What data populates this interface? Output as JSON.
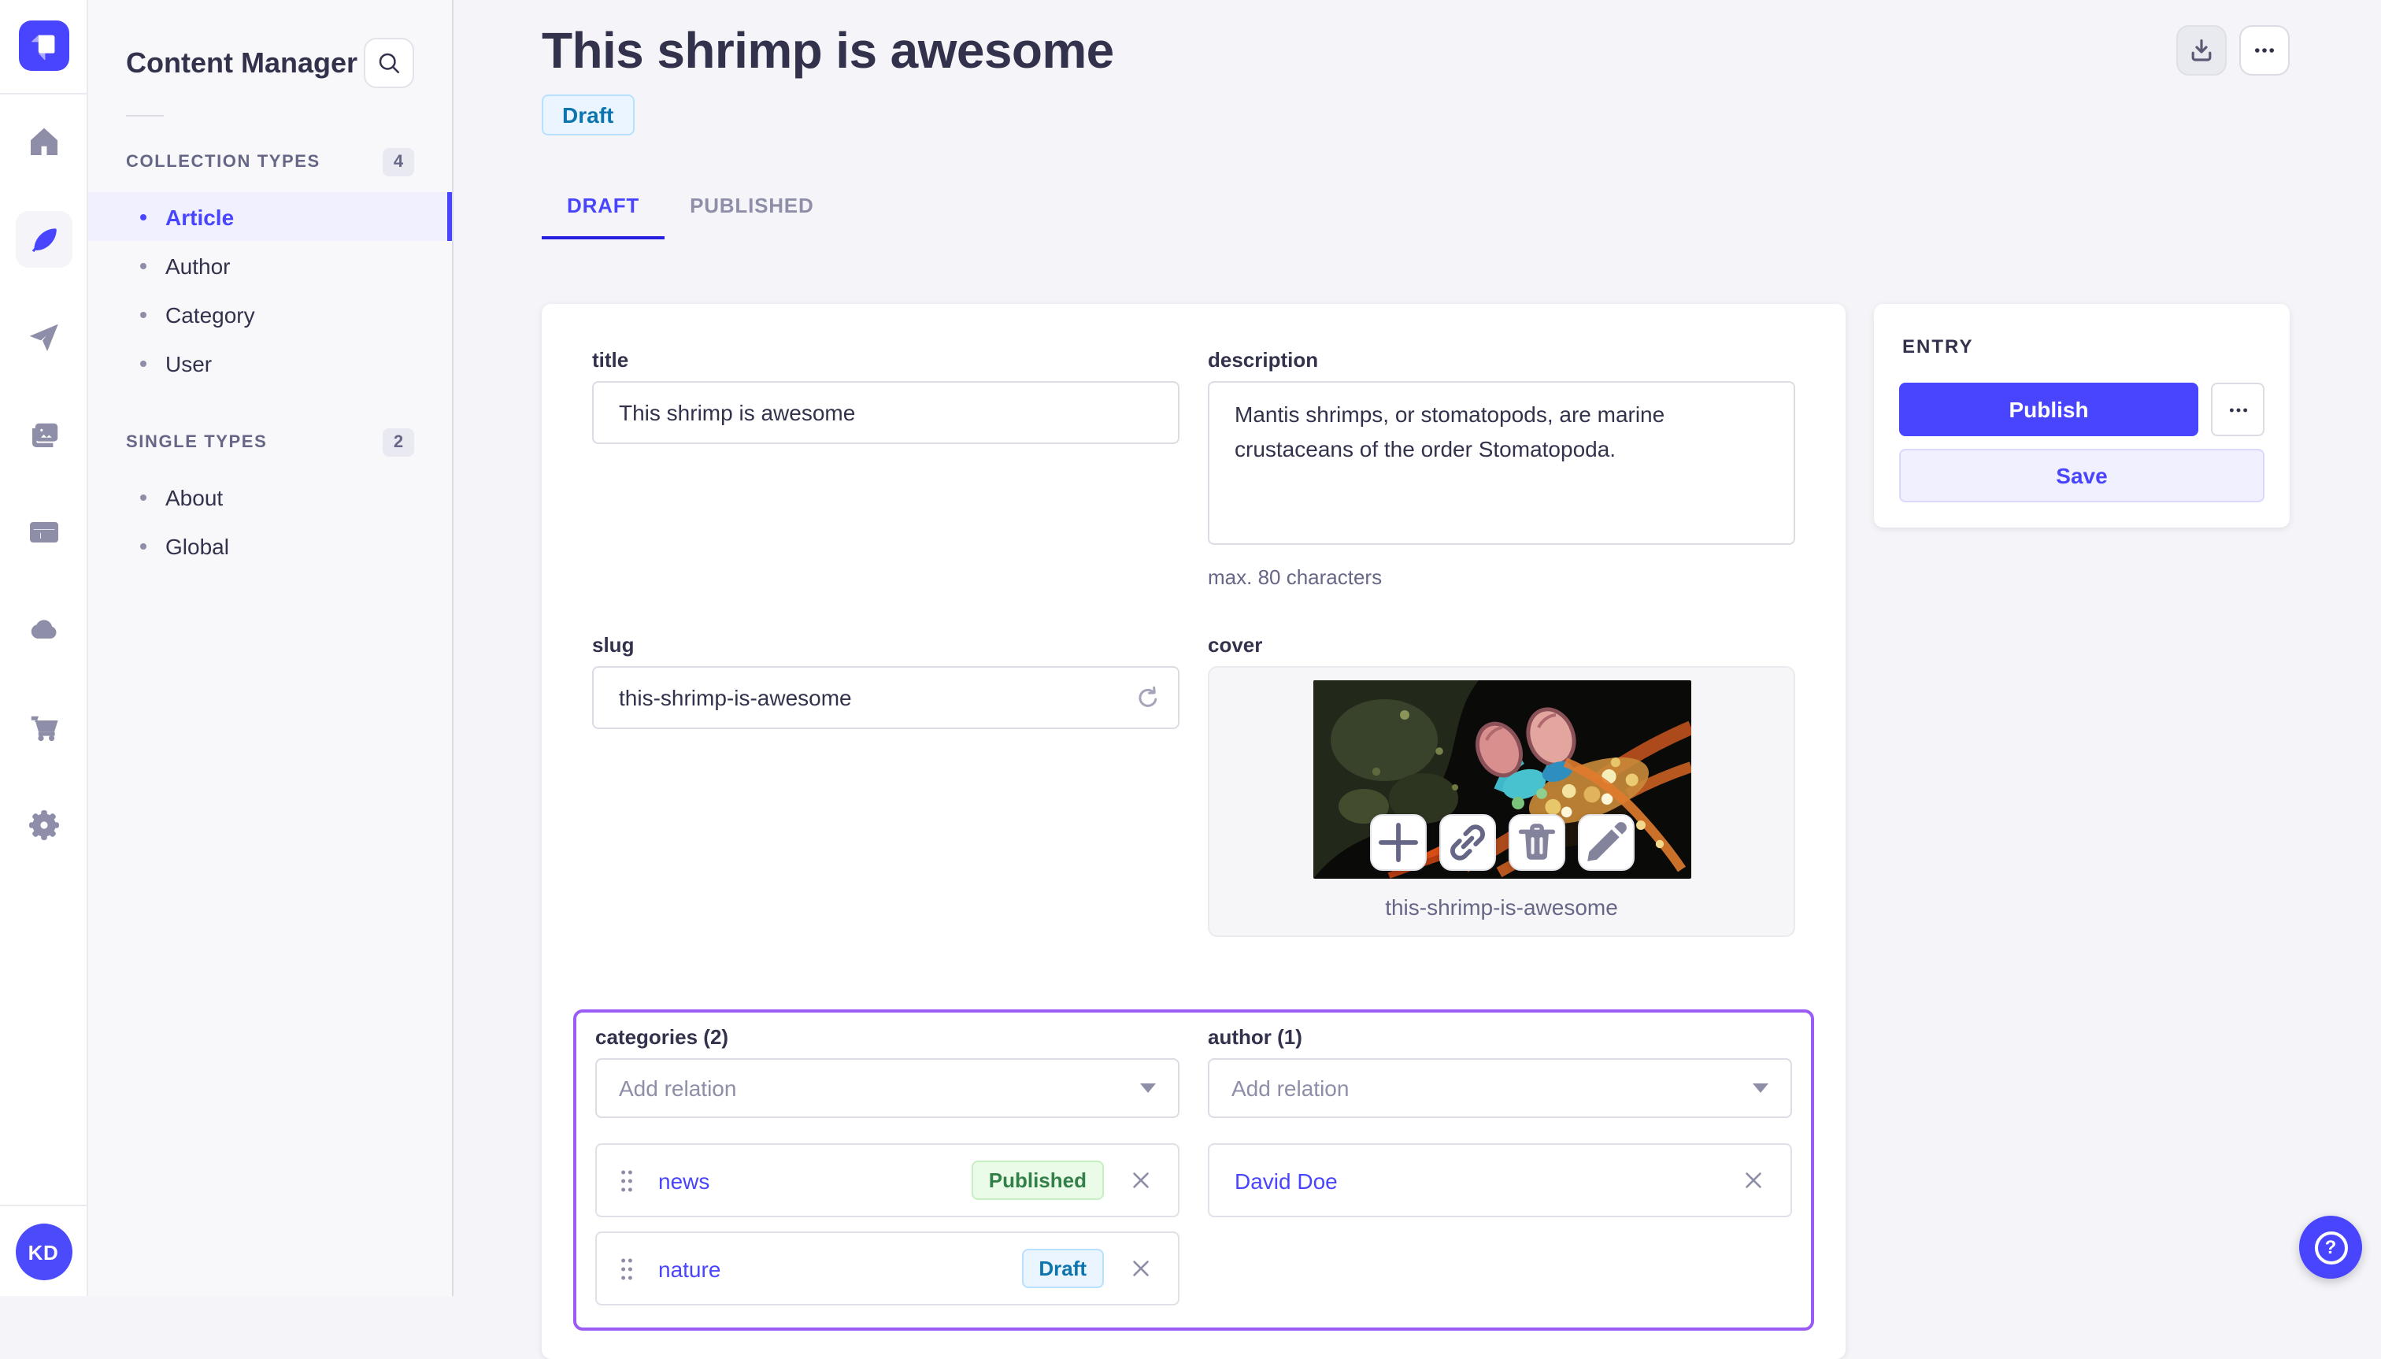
{
  "colors": {
    "primary": "#4945FF",
    "focus_outline": "#9B5CF6",
    "draft_badge_bg": "#EAF5FF",
    "draft_badge_text": "#0C75AF",
    "published_badge_bg": "#EAFBE7",
    "published_badge_text": "#328048",
    "text_dark": "#32324D",
    "text_muted": "#666687"
  },
  "rail": {
    "logo": "strapi-logo",
    "items": [
      {
        "icon": "home-icon",
        "active": false
      },
      {
        "icon": "feather-content-icon",
        "active": true
      },
      {
        "icon": "send-icon",
        "active": false
      },
      {
        "icon": "media-images-icon",
        "active": false
      },
      {
        "icon": "layout-icon",
        "active": false
      },
      {
        "icon": "cloud-icon",
        "active": false
      },
      {
        "icon": "cart-icon",
        "active": false
      },
      {
        "icon": "gear-icon",
        "active": false
      }
    ],
    "avatar_initials": "KD"
  },
  "subnav": {
    "title": "Content Manager",
    "sections": [
      {
        "label": "COLLECTION TYPES",
        "count": "4",
        "items": [
          {
            "label": "Article",
            "active": true
          },
          {
            "label": "Author",
            "active": false
          },
          {
            "label": "Category",
            "active": false
          },
          {
            "label": "User",
            "active": false
          }
        ]
      },
      {
        "label": "SINGLE TYPES",
        "count": "2",
        "items": [
          {
            "label": "About",
            "active": false
          },
          {
            "label": "Global",
            "active": false
          }
        ]
      }
    ]
  },
  "header": {
    "title": "This shrimp is awesome",
    "status": "Draft",
    "tabs": [
      {
        "label": "DRAFT",
        "active": true
      },
      {
        "label": "PUBLISHED",
        "active": false
      }
    ]
  },
  "form": {
    "title": {
      "label": "title",
      "value": "This shrimp is awesome"
    },
    "description": {
      "label": "description",
      "value": "Mantis shrimps, or stomatopods, are marine crustaceans of the order Stomatopoda.",
      "helper": "max. 80 characters"
    },
    "slug": {
      "label": "slug",
      "value": "this-shrimp-is-awesome"
    },
    "cover": {
      "label": "cover",
      "caption": "this-shrimp-is-awesome"
    },
    "categories": {
      "label": "categories (2)",
      "placeholder": "Add relation",
      "relations": [
        {
          "name": "news",
          "status": "Published"
        },
        {
          "name": "nature",
          "status": "Draft"
        }
      ]
    },
    "author": {
      "label": "author (1)",
      "placeholder": "Add relation",
      "relations": [
        {
          "name": "David Doe"
        }
      ]
    }
  },
  "entry_panel": {
    "heading": "ENTRY",
    "publish_label": "Publish",
    "save_label": "Save"
  },
  "fab": {
    "glyph": "?"
  }
}
